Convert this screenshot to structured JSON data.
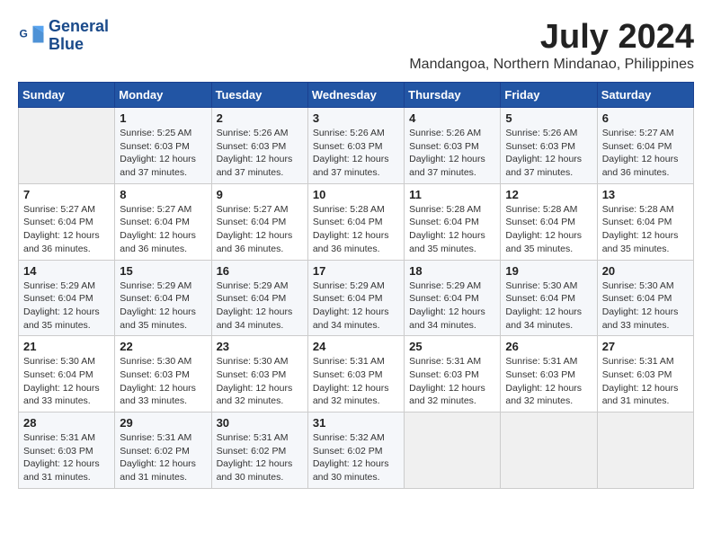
{
  "header": {
    "logo_line1": "General",
    "logo_line2": "Blue",
    "month_year": "July 2024",
    "location": "Mandangoa, Northern Mindanao, Philippines"
  },
  "days_of_week": [
    "Sunday",
    "Monday",
    "Tuesday",
    "Wednesday",
    "Thursday",
    "Friday",
    "Saturday"
  ],
  "weeks": [
    [
      {
        "day": "",
        "info": ""
      },
      {
        "day": "1",
        "info": "Sunrise: 5:25 AM\nSunset: 6:03 PM\nDaylight: 12 hours\nand 37 minutes."
      },
      {
        "day": "2",
        "info": "Sunrise: 5:26 AM\nSunset: 6:03 PM\nDaylight: 12 hours\nand 37 minutes."
      },
      {
        "day": "3",
        "info": "Sunrise: 5:26 AM\nSunset: 6:03 PM\nDaylight: 12 hours\nand 37 minutes."
      },
      {
        "day": "4",
        "info": "Sunrise: 5:26 AM\nSunset: 6:03 PM\nDaylight: 12 hours\nand 37 minutes."
      },
      {
        "day": "5",
        "info": "Sunrise: 5:26 AM\nSunset: 6:03 PM\nDaylight: 12 hours\nand 37 minutes."
      },
      {
        "day": "6",
        "info": "Sunrise: 5:27 AM\nSunset: 6:04 PM\nDaylight: 12 hours\nand 36 minutes."
      }
    ],
    [
      {
        "day": "7",
        "info": "Sunrise: 5:27 AM\nSunset: 6:04 PM\nDaylight: 12 hours\nand 36 minutes."
      },
      {
        "day": "8",
        "info": "Sunrise: 5:27 AM\nSunset: 6:04 PM\nDaylight: 12 hours\nand 36 minutes."
      },
      {
        "day": "9",
        "info": "Sunrise: 5:27 AM\nSunset: 6:04 PM\nDaylight: 12 hours\nand 36 minutes."
      },
      {
        "day": "10",
        "info": "Sunrise: 5:28 AM\nSunset: 6:04 PM\nDaylight: 12 hours\nand 36 minutes."
      },
      {
        "day": "11",
        "info": "Sunrise: 5:28 AM\nSunset: 6:04 PM\nDaylight: 12 hours\nand 35 minutes."
      },
      {
        "day": "12",
        "info": "Sunrise: 5:28 AM\nSunset: 6:04 PM\nDaylight: 12 hours\nand 35 minutes."
      },
      {
        "day": "13",
        "info": "Sunrise: 5:28 AM\nSunset: 6:04 PM\nDaylight: 12 hours\nand 35 minutes."
      }
    ],
    [
      {
        "day": "14",
        "info": "Sunrise: 5:29 AM\nSunset: 6:04 PM\nDaylight: 12 hours\nand 35 minutes."
      },
      {
        "day": "15",
        "info": "Sunrise: 5:29 AM\nSunset: 6:04 PM\nDaylight: 12 hours\nand 35 minutes."
      },
      {
        "day": "16",
        "info": "Sunrise: 5:29 AM\nSunset: 6:04 PM\nDaylight: 12 hours\nand 34 minutes."
      },
      {
        "day": "17",
        "info": "Sunrise: 5:29 AM\nSunset: 6:04 PM\nDaylight: 12 hours\nand 34 minutes."
      },
      {
        "day": "18",
        "info": "Sunrise: 5:29 AM\nSunset: 6:04 PM\nDaylight: 12 hours\nand 34 minutes."
      },
      {
        "day": "19",
        "info": "Sunrise: 5:30 AM\nSunset: 6:04 PM\nDaylight: 12 hours\nand 34 minutes."
      },
      {
        "day": "20",
        "info": "Sunrise: 5:30 AM\nSunset: 6:04 PM\nDaylight: 12 hours\nand 33 minutes."
      }
    ],
    [
      {
        "day": "21",
        "info": "Sunrise: 5:30 AM\nSunset: 6:04 PM\nDaylight: 12 hours\nand 33 minutes."
      },
      {
        "day": "22",
        "info": "Sunrise: 5:30 AM\nSunset: 6:03 PM\nDaylight: 12 hours\nand 33 minutes."
      },
      {
        "day": "23",
        "info": "Sunrise: 5:30 AM\nSunset: 6:03 PM\nDaylight: 12 hours\nand 32 minutes."
      },
      {
        "day": "24",
        "info": "Sunrise: 5:31 AM\nSunset: 6:03 PM\nDaylight: 12 hours\nand 32 minutes."
      },
      {
        "day": "25",
        "info": "Sunrise: 5:31 AM\nSunset: 6:03 PM\nDaylight: 12 hours\nand 32 minutes."
      },
      {
        "day": "26",
        "info": "Sunrise: 5:31 AM\nSunset: 6:03 PM\nDaylight: 12 hours\nand 32 minutes."
      },
      {
        "day": "27",
        "info": "Sunrise: 5:31 AM\nSunset: 6:03 PM\nDaylight: 12 hours\nand 31 minutes."
      }
    ],
    [
      {
        "day": "28",
        "info": "Sunrise: 5:31 AM\nSunset: 6:03 PM\nDaylight: 12 hours\nand 31 minutes."
      },
      {
        "day": "29",
        "info": "Sunrise: 5:31 AM\nSunset: 6:02 PM\nDaylight: 12 hours\nand 31 minutes."
      },
      {
        "day": "30",
        "info": "Sunrise: 5:31 AM\nSunset: 6:02 PM\nDaylight: 12 hours\nand 30 minutes."
      },
      {
        "day": "31",
        "info": "Sunrise: 5:32 AM\nSunset: 6:02 PM\nDaylight: 12 hours\nand 30 minutes."
      },
      {
        "day": "",
        "info": ""
      },
      {
        "day": "",
        "info": ""
      },
      {
        "day": "",
        "info": ""
      }
    ]
  ]
}
